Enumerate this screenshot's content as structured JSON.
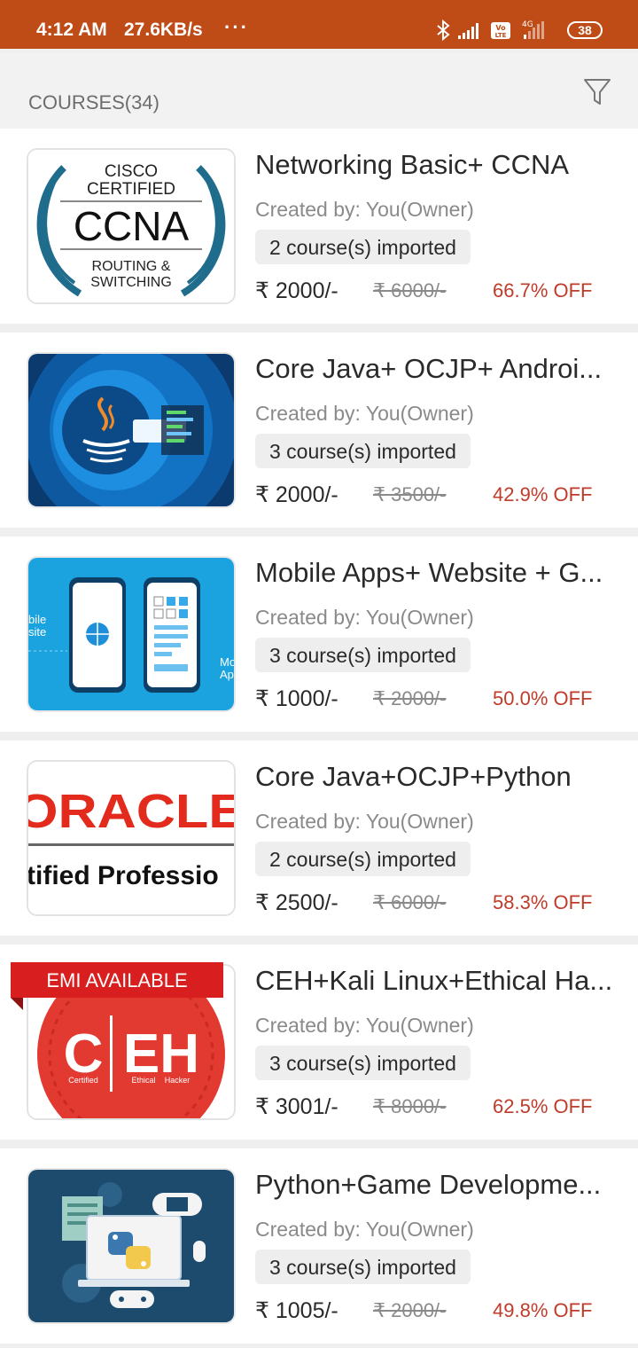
{
  "status_bar": {
    "time": "4:12 AM",
    "speed": "27.6KB/s",
    "dots": "···",
    "battery": "38"
  },
  "header": {
    "title": "COURSES(34)"
  },
  "courses": [
    {
      "title": "Networking Basic+ CCNA",
      "creator": "Created by: You(Owner)",
      "imported": "2 course(s) imported",
      "price": "₹ 2000/-",
      "old_price": "₹ 6000/-",
      "discount": "66.7% OFF",
      "thumb": {
        "l1": "CISCO",
        "l2": "CERTIFIED",
        "l3": "CCNA",
        "l4": "ROUTING &",
        "l5": "SWITCHING"
      }
    },
    {
      "title": "Core Java+ OCJP+ Androi...",
      "creator": "Created by: You(Owner)",
      "imported": "3 course(s) imported",
      "price": "₹ 2000/-",
      "old_price": "₹ 3500/-",
      "discount": "42.9% OFF"
    },
    {
      "title": "Mobile Apps+ Website + G...",
      "creator": "Created by: You(Owner)",
      "imported": "3 course(s) imported",
      "price": "₹ 1000/-",
      "old_price": "₹ 2000/-",
      "discount": "50.0% OFF",
      "thumb": {
        "l1": "bile",
        "l2": "site",
        "r1": "Mo",
        "r2": "Ap"
      }
    },
    {
      "title": "Core Java+OCJP+Python",
      "creator": "Created by: You(Owner)",
      "imported": "2 course(s) imported",
      "price": "₹ 2500/-",
      "old_price": "₹ 6000/-",
      "discount": "58.3% OFF",
      "thumb": {
        "l1": "ORACLE",
        "l2": "tified Professio"
      }
    },
    {
      "title": "CEH+Kali Linux+Ethical Ha...",
      "creator": "Created by: You(Owner)",
      "imported": "3 course(s) imported",
      "price": "₹ 3001/-",
      "old_price": "₹ 8000/-",
      "discount": "62.5% OFF",
      "badge": "EMI AVAILABLE",
      "thumb": {
        "l1": "C",
        "l2": "EH",
        "l3": "Certified",
        "l4": "Ethical",
        "l5": "Hacker"
      }
    },
    {
      "title": "Python+Game Developme...",
      "creator": "Created by: You(Owner)",
      "imported": "3 course(s) imported",
      "price": "₹ 1005/-",
      "old_price": "₹ 2000/-",
      "discount": "49.8% OFF"
    }
  ]
}
